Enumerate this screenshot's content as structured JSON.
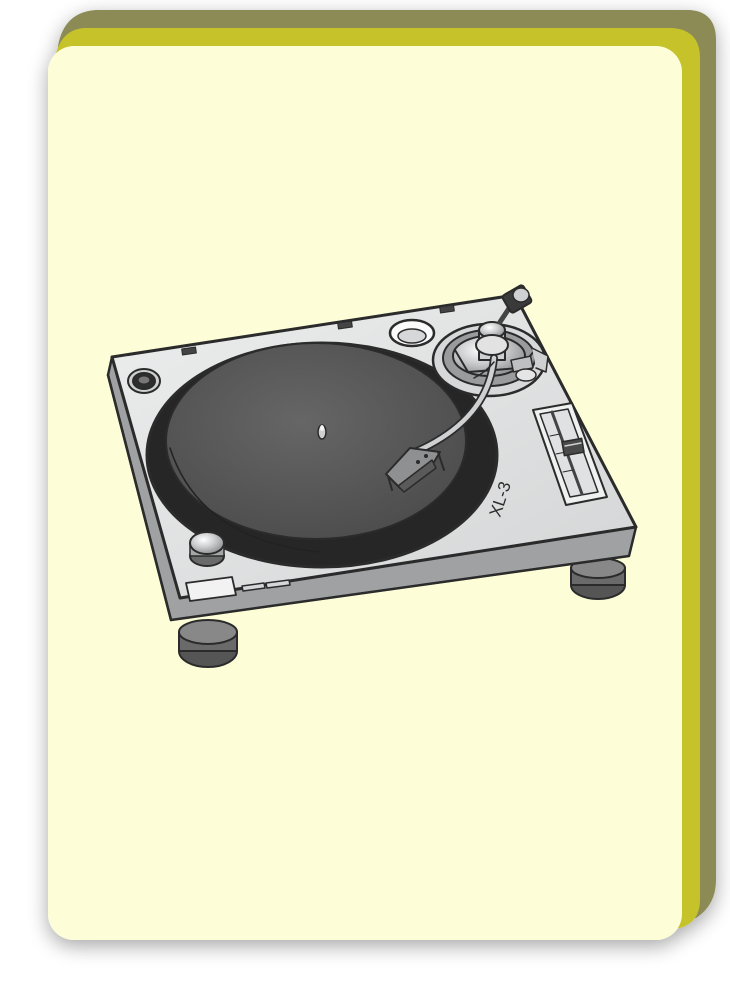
{
  "card": {
    "back_color": "#8c8b57",
    "middle_color": "#c5c22a",
    "front_color": "#fdfed7"
  },
  "turntable": {
    "model_label": "XL-3",
    "body_color": "#e1e2e3",
    "platter_color": "#585858",
    "mat_color": "#3e3e3e",
    "outline_color": "#2b2b2b"
  },
  "icons": {
    "main": "turntable-icon"
  }
}
